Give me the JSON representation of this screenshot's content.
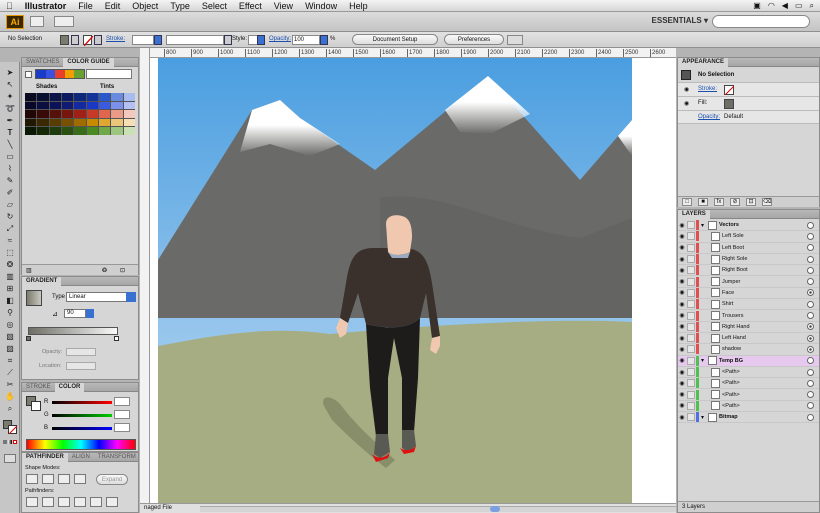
{
  "menubar": {
    "apple": "",
    "app_name": "Illustrator",
    "items": [
      "File",
      "Edit",
      "Object",
      "Type",
      "Select",
      "Effect",
      "View",
      "Window",
      "Help"
    ]
  },
  "appbar": {
    "logo": "Ai",
    "workspace": "ESSENTIALS ▾"
  },
  "control_bar": {
    "selection": "No Selection",
    "stroke_label": "Stroke:",
    "style_label": "Style:",
    "opacity_label": "Opacity:",
    "opacity_value": "100",
    "opacity_unit": "%",
    "document_setup": "Document Setup",
    "preferences": "Preferences"
  },
  "ruler": {
    "ticks": [
      "800",
      "900",
      "1000",
      "1100",
      "1200",
      "1300",
      "1400",
      "1500",
      "1600",
      "1700",
      "1800",
      "1900",
      "2000",
      "2100",
      "2200",
      "2300",
      "2400",
      "2500",
      "2600"
    ]
  },
  "swatches_panel": {
    "tabs": [
      "SWATCHES",
      "COLOR GUIDE"
    ],
    "shades_label": "Shades",
    "tints_label": "Tints",
    "guide_colors": [
      "#1a3ac8",
      "#3a50e0",
      "#e8402a",
      "#f0a000",
      "#6aa030"
    ],
    "grid_rows": [
      [
        "#0a0a20",
        "#0a1030",
        "#0a1448",
        "#0c1c60",
        "#10287a",
        "#14349a",
        "#2a58c8",
        "#6a8ae0",
        "#a8bcf0"
      ],
      [
        "#080828",
        "#0a0e40",
        "#0c1258",
        "#101a70",
        "#1428a0",
        "#1a38c8",
        "#3a5ae0",
        "#7a90ea",
        "#b4c0f4"
      ],
      [
        "#200806",
        "#3a0a08",
        "#58100a",
        "#78160e",
        "#a02018",
        "#c83a28",
        "#e06650",
        "#ec9a88",
        "#f4c8bc"
      ],
      [
        "#201800",
        "#3a2800",
        "#583c00",
        "#785000",
        "#a06c00",
        "#c88a00",
        "#e0a830",
        "#ecc678",
        "#f4e0b4"
      ],
      [
        "#0c1806",
        "#142808",
        "#1e3c0c",
        "#2a5012",
        "#386c18",
        "#4a8a22",
        "#70a848",
        "#9cc680",
        "#c8e0b4"
      ]
    ]
  },
  "gradient_panel": {
    "tab": "GRADIENT",
    "type_label": "Type",
    "type_value": "Linear",
    "angle_value": "90",
    "opacity_label": "Opacity:",
    "location_label": "Location:"
  },
  "stroke_panel": {
    "tabs": [
      "STROKE",
      "COLOR"
    ],
    "channels": [
      "R",
      "G",
      "B"
    ]
  },
  "pathfinder_panel": {
    "tabs": [
      "PATHFINDER",
      "ALIGN",
      "TRANSFORM"
    ],
    "shape_modes_label": "Shape Modes:",
    "pathfinders_label": "Pathfinders:",
    "expand_label": "Expand"
  },
  "appearance_panel": {
    "tab": "APPEARANCE",
    "selection": "No Selection",
    "stroke_label": "Stroke:",
    "fill_label": "Fill:",
    "opacity_label": "Opacity:",
    "opacity_value": "Default"
  },
  "layers_panel": {
    "tab": "LAYERS",
    "footer": "3 Layers",
    "rows": [
      {
        "name": "Vectors",
        "top": true,
        "color": "#e05050",
        "target_filled": false
      },
      {
        "name": "Left Sole",
        "top": false,
        "color": "#e05050",
        "target_filled": false
      },
      {
        "name": "Left Boot",
        "top": false,
        "color": "#e05050",
        "target_filled": false
      },
      {
        "name": "Right Sole",
        "top": false,
        "color": "#e05050",
        "target_filled": false
      },
      {
        "name": "Right Boot",
        "top": false,
        "color": "#e05050",
        "target_filled": false
      },
      {
        "name": "Jumper",
        "top": false,
        "color": "#e05050",
        "target_filled": false
      },
      {
        "name": "Face",
        "top": false,
        "color": "#e05050",
        "target_filled": true
      },
      {
        "name": "Shirt",
        "top": false,
        "color": "#e05050",
        "target_filled": false
      },
      {
        "name": "Trousers",
        "top": false,
        "color": "#e05050",
        "target_filled": false
      },
      {
        "name": "Right Hand",
        "top": false,
        "color": "#e05050",
        "target_filled": true
      },
      {
        "name": "Left Hand",
        "top": false,
        "color": "#e05050",
        "target_filled": true
      },
      {
        "name": "shadow",
        "top": false,
        "color": "#e05050",
        "target_filled": true
      },
      {
        "name": "Temp BG",
        "top": true,
        "color": "#50c050",
        "target_filled": false,
        "highlight": true
      },
      {
        "name": "<Path>",
        "top": false,
        "color": "#50c050",
        "target_filled": false
      },
      {
        "name": "<Path>",
        "top": false,
        "color": "#50c050",
        "target_filled": false
      },
      {
        "name": "<Path>",
        "top": false,
        "color": "#50c050",
        "target_filled": false
      },
      {
        "name": "<Path>",
        "top": false,
        "color": "#50c050",
        "target_filled": false
      },
      {
        "name": "Bitmap",
        "top": true,
        "color": "#5070e0",
        "target_filled": false
      }
    ]
  },
  "statusbar": {
    "text": "naged File"
  },
  "artwork": {
    "sky_top": "#4a9ee0",
    "sky_bottom": "#c8dff4",
    "mountain": "#6a6a68",
    "snow": "#ffffff",
    "grass": "#a6ad82",
    "jumper": "#3a302c",
    "trousers": "#1e1c1a",
    "skin": "#f0c8b0",
    "sole": "#e01010"
  }
}
